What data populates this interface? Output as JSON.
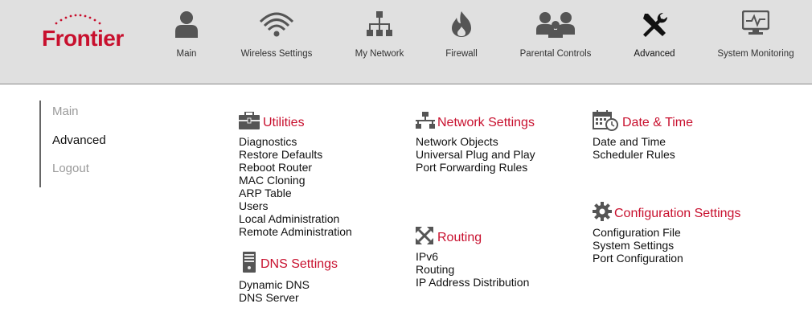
{
  "brand": {
    "logo_text": "Frontier",
    "color": "#c8102e"
  },
  "nav": [
    {
      "label": "Main",
      "icon": "user-icon"
    },
    {
      "label": "Wireless Settings",
      "icon": "wifi-icon"
    },
    {
      "label": "My Network",
      "icon": "network-tree-icon"
    },
    {
      "label": "Firewall",
      "icon": "flame-icon"
    },
    {
      "label": "Parental Controls",
      "icon": "family-icon"
    },
    {
      "label": "Advanced",
      "icon": "tools-icon",
      "active": true
    },
    {
      "label": "System Monitoring",
      "icon": "monitor-icon"
    }
  ],
  "sidebar": {
    "items": [
      {
        "label": "Main"
      },
      {
        "label": "Advanced",
        "active": true
      },
      {
        "label": "Logout"
      }
    ]
  },
  "sections": {
    "utilities": {
      "title": "Utilities",
      "icon": "toolbox-icon",
      "links": [
        "Diagnostics",
        "Restore Defaults",
        "Reboot Router",
        "MAC Cloning",
        "ARP Table",
        "Users",
        "Local Administration",
        "Remote Administration"
      ]
    },
    "dns": {
      "title": "DNS Settings",
      "icon": "server-icon",
      "links": [
        "Dynamic DNS",
        "DNS Server"
      ]
    },
    "network": {
      "title": "Network Settings",
      "icon": "network-icon",
      "links": [
        "Network Objects",
        "Universal Plug and Play",
        "Port Forwarding Rules"
      ]
    },
    "routing": {
      "title": "Routing",
      "icon": "routing-arrows-icon",
      "links": [
        "IPv6",
        "Routing",
        "IP Address Distribution"
      ]
    },
    "datetime": {
      "title": "Date & Time",
      "icon": "calendar-clock-icon",
      "links": [
        "Date and Time",
        "Scheduler Rules"
      ]
    },
    "config": {
      "title": "Configuration Settings",
      "icon": "gear-icon",
      "links": [
        "Configuration File",
        "System Settings",
        "Port Configuration"
      ]
    }
  },
  "colors": {
    "accent": "#c8102e",
    "header_bg": "#e0e0e0",
    "icon": "#555555"
  }
}
